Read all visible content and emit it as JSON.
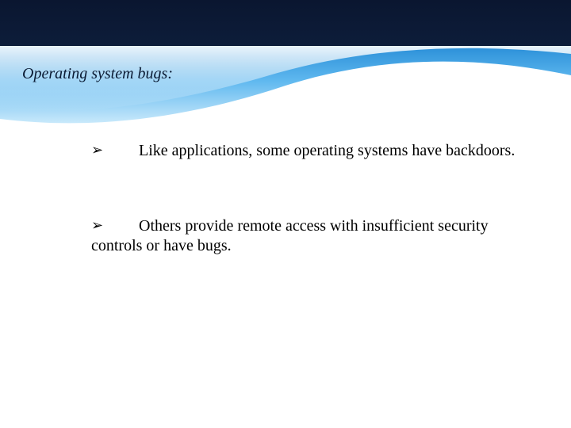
{
  "title": "Operating system bugs:",
  "bullets": [
    {
      "marker": "➢",
      "text": "Like applications, some operating systems have backdoors."
    },
    {
      "marker": "➢",
      "text": "Others provide remote access with insufficient security controls or have bugs."
    }
  ],
  "colors": {
    "dark_navy": "#0d1d3a",
    "light_blue": "#6ec1f5",
    "mid_blue": "#3fa8e8",
    "white": "#ffffff"
  }
}
